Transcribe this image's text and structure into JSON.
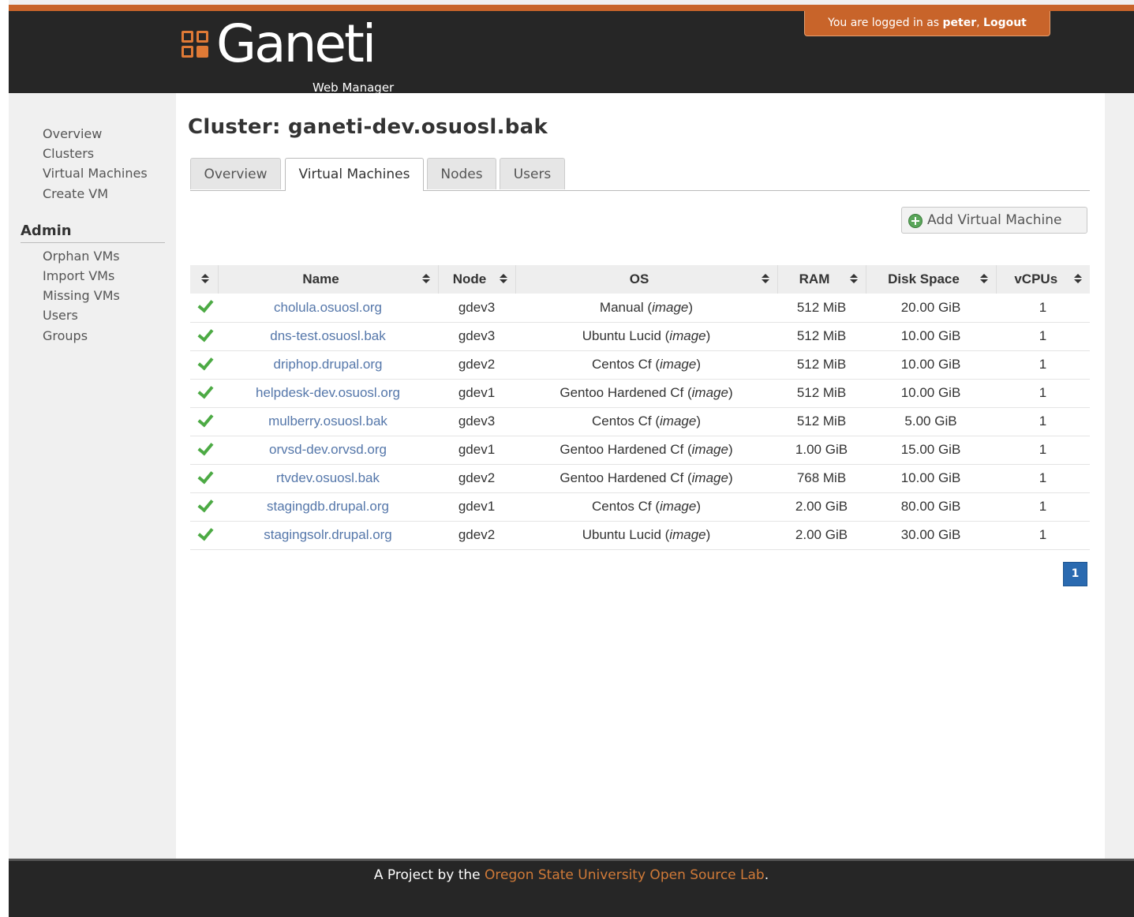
{
  "header": {
    "logo_text": "Ganeti",
    "logo_sub": "Web Manager",
    "login_prefix": "You are logged in as",
    "username": "peter",
    "separator": ",",
    "logout_label": "Logout"
  },
  "sidebar": {
    "items": [
      "Overview",
      "Clusters",
      "Virtual Machines",
      "Create VM"
    ],
    "admin_title": "Admin",
    "admin_items": [
      "Orphan VMs",
      "Import VMs",
      "Missing VMs",
      "Users",
      "Groups"
    ]
  },
  "main": {
    "title": "Cluster: ganeti-dev.osuosl.bak",
    "tabs": [
      "Overview",
      "Virtual Machines",
      "Nodes",
      "Users"
    ],
    "active_tab": "Virtual Machines",
    "add_button": "Add Virtual Machine",
    "table": {
      "headers": [
        "Name",
        "Node",
        "OS",
        "RAM",
        "Disk Space",
        "vCPUs"
      ],
      "rows": [
        {
          "status": "running",
          "name": "cholula.osuosl.org",
          "node": "gdev3",
          "os": "Manual",
          "os_type": "image",
          "ram": "512 MiB",
          "disk": "20.00 GiB",
          "vcpus": "1"
        },
        {
          "status": "running",
          "name": "dns-test.osuosl.bak",
          "node": "gdev3",
          "os": "Ubuntu Lucid",
          "os_type": "image",
          "ram": "512 MiB",
          "disk": "10.00 GiB",
          "vcpus": "1"
        },
        {
          "status": "running",
          "name": "driphop.drupal.org",
          "node": "gdev2",
          "os": "Centos Cf",
          "os_type": "image",
          "ram": "512 MiB",
          "disk": "10.00 GiB",
          "vcpus": "1"
        },
        {
          "status": "running",
          "name": "helpdesk-dev.osuosl.org",
          "node": "gdev1",
          "os": "Gentoo Hardened Cf",
          "os_type": "image",
          "ram": "512 MiB",
          "disk": "10.00 GiB",
          "vcpus": "1"
        },
        {
          "status": "running",
          "name": "mulberry.osuosl.bak",
          "node": "gdev3",
          "os": "Centos Cf",
          "os_type": "image",
          "ram": "512 MiB",
          "disk": "5.00 GiB",
          "vcpus": "1"
        },
        {
          "status": "running",
          "name": "orvsd-dev.orvsd.org",
          "node": "gdev1",
          "os": "Gentoo Hardened Cf",
          "os_type": "image",
          "ram": "1.00 GiB",
          "disk": "15.00 GiB",
          "vcpus": "1"
        },
        {
          "status": "running",
          "name": "rtvdev.osuosl.bak",
          "node": "gdev2",
          "os": "Gentoo Hardened Cf",
          "os_type": "image",
          "ram": "768 MiB",
          "disk": "10.00 GiB",
          "vcpus": "1"
        },
        {
          "status": "running",
          "name": "stagingdb.drupal.org",
          "node": "gdev1",
          "os": "Centos Cf",
          "os_type": "image",
          "ram": "2.00 GiB",
          "disk": "80.00 GiB",
          "vcpus": "1"
        },
        {
          "status": "running",
          "name": "stagingsolr.drupal.org",
          "node": "gdev2",
          "os": "Ubuntu Lucid",
          "os_type": "image",
          "ram": "2.00 GiB",
          "disk": "30.00 GiB",
          "vcpus": "1"
        }
      ]
    },
    "pagination": {
      "current_page": "1"
    }
  },
  "footer": {
    "prefix": "A Project by the",
    "lab_name": "Oregon State University Open Source Lab",
    "suffix": "."
  },
  "colors": {
    "accent": "#c8642a",
    "header_bg": "#262626",
    "link": "#5577aa",
    "status_ok": "#4caa44",
    "page_active": "#2a6ab0"
  }
}
